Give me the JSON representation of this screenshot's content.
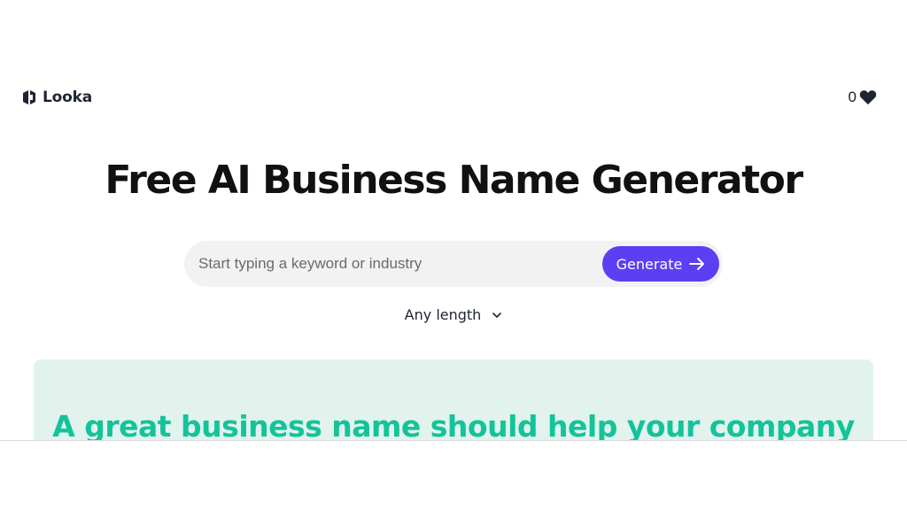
{
  "header": {
    "brand": "Looka",
    "favorites_count": "0",
    "logo_icon": "looka-logo-icon",
    "favorites_icon": "heart-icon"
  },
  "main": {
    "title": "Free AI Business Name Generator",
    "search": {
      "placeholder": "Start typing a keyword or industry",
      "value": "",
      "button_label": "Generate",
      "button_icon": "arrow-right-icon"
    },
    "length_filter": {
      "selected": "Any length",
      "icon": "chevron-down-icon"
    },
    "info": {
      "heading": "A great business name should help your company"
    }
  },
  "colors": {
    "accent": "#5b3ff2",
    "info_bg": "#e1f3ec",
    "info_text": "#14c39a",
    "search_bg": "#f2f2f2"
  }
}
